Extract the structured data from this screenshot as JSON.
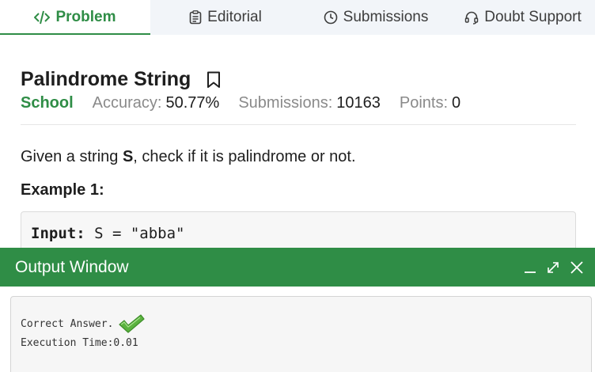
{
  "tabs": [
    {
      "label": "Problem",
      "icon": "code-icon",
      "active": true
    },
    {
      "label": "Editorial",
      "icon": "document-icon",
      "active": false
    },
    {
      "label": "Submissions",
      "icon": "clock-icon",
      "active": false
    },
    {
      "label": "Doubt Support",
      "icon": "headset-icon",
      "active": false
    }
  ],
  "problem": {
    "title": "Palindrome String",
    "difficulty": "School",
    "accuracy_label": "Accuracy:",
    "accuracy_value": "50.77%",
    "submissions_label": "Submissions:",
    "submissions_value": "10163",
    "points_label": "Points:",
    "points_value": "0",
    "description_pre": "Given a string ",
    "description_var": "S",
    "description_post": ", check if it is palindrome or not.",
    "example_heading": "Example 1:",
    "example_input_label": "Input:",
    "example_input_value": " S = \"abba\""
  },
  "output_window": {
    "title": "Output Window",
    "result_text": "Correct Answer.",
    "execution_time": "Execution Time:0.01"
  },
  "colors": {
    "accent": "#2f8d46",
    "tab_bar": "#f2f5f9",
    "panel": "#f6f6f6"
  }
}
